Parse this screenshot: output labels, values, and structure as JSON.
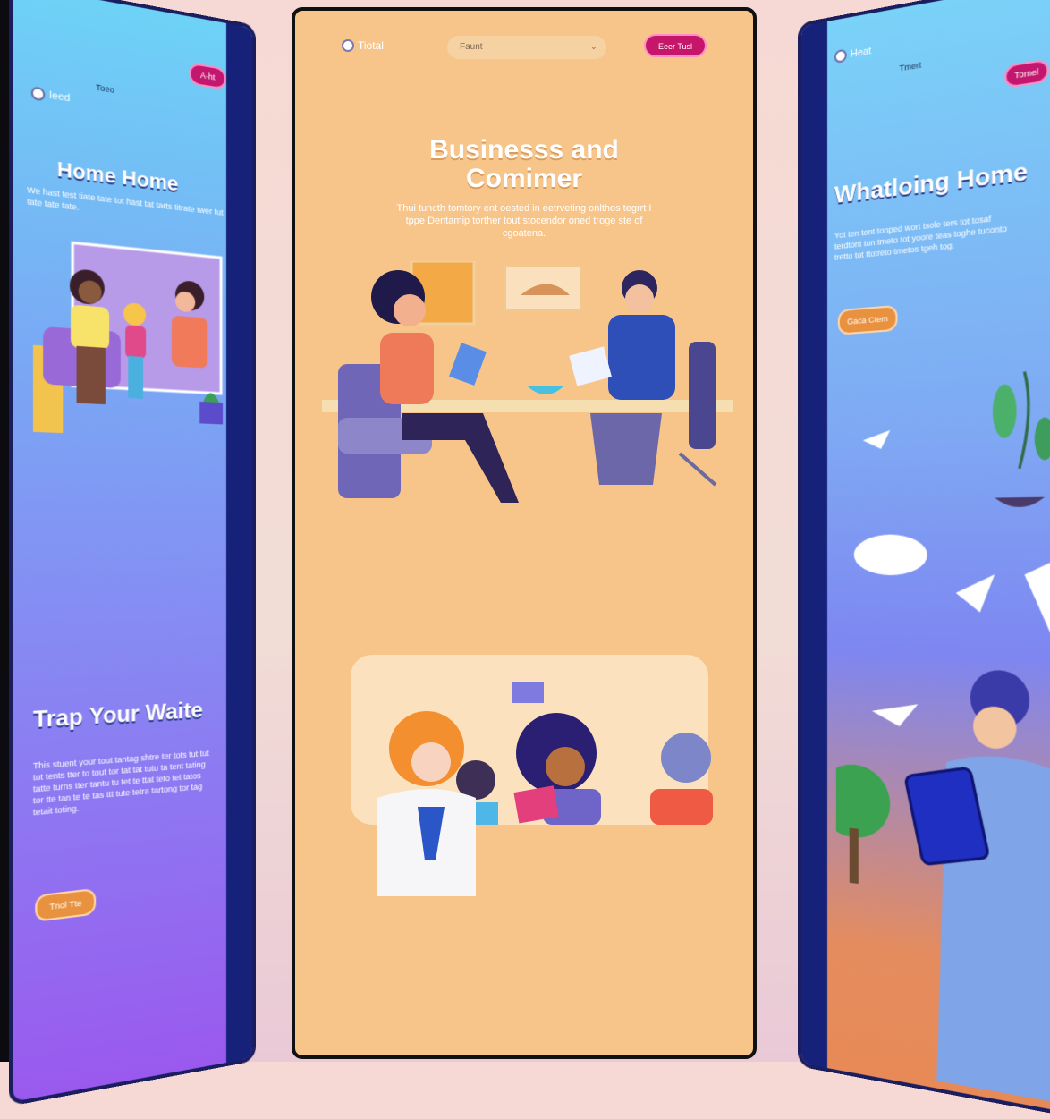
{
  "left_panel": {
    "logo_text": "Ieed",
    "nav_text": "Toeo",
    "cta_label": "A-ht",
    "hero_title": "Home Home",
    "hero_text": "We hast test tiate tate tot hast tat tarts titrate twer tut tate tate tate.",
    "section_title": "Trap Your Waite",
    "section_text": "This stuent your tout tantag shtre ter tots tut tut tot tents tter to tout tor tat tat tutu ta tent tating tatte turns tter tantu tu tet te ttat teto tet tatos tor tte tan te te tas ttt tute tetra tartong tor tag tetait toting.",
    "button_label": "Tnol Tte"
  },
  "center_panel": {
    "logo_text": "Tiotal",
    "search_placeholder": "Faunt",
    "cta_label": "Eeer Tusl",
    "hero_title_line1": "Businesss and",
    "hero_title_line2": "Comimer",
    "hero_text": "Thui tuncth tomtory ent oested in eetrveting onlthos tegrrt I tppe Dentamip torther tout stocendor oned troge ste of cgoatena."
  },
  "right_panel": {
    "logo_text": "Heat",
    "nav_text": "Tmert",
    "cta_label": "Tomel",
    "hero_title": "Whatloing Home",
    "hero_text": "Yot ten tent tonped wort tsole ters tot tosaf terdtont ton tmeto tot yoore teas toghe tuconto tretto tot ttotreto tmetos tgeh tog.",
    "button_label": "Gaca Ctem"
  },
  "colors": {
    "center_bg": "#f7c58a",
    "accent_magenta": "#c6166a",
    "accent_orange": "#e8913e",
    "panel_edge": "#1a1d5e"
  }
}
